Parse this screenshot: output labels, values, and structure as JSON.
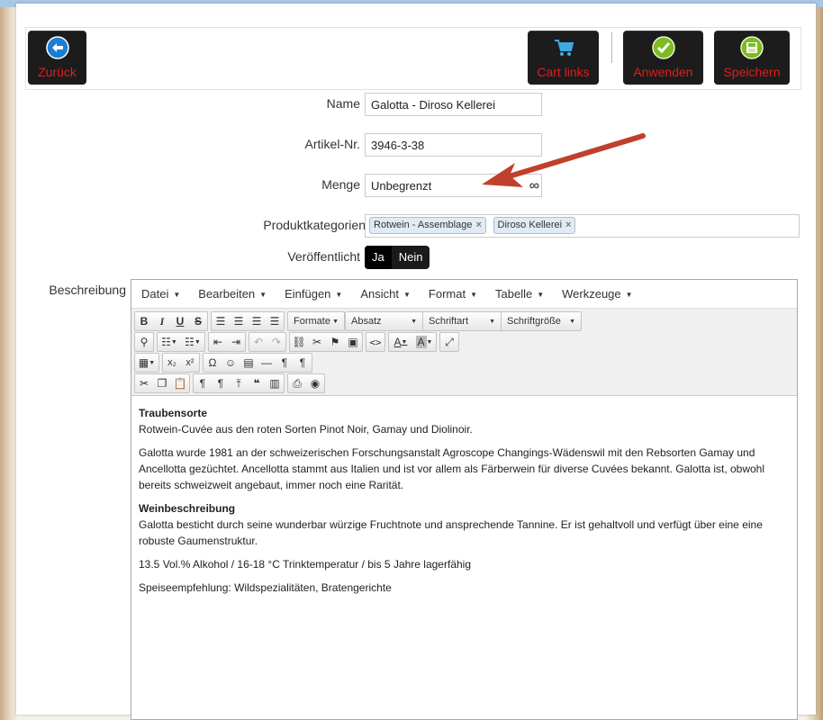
{
  "toolbar": {
    "back_label": "Zurück",
    "cart_label": "Cart links",
    "apply_label": "Anwenden",
    "save_label": "Speichern"
  },
  "form": {
    "name_label": "Name",
    "name_value": "Galotta - Diroso Kellerei",
    "sku_label": "Artikel-Nr.",
    "sku_value": "3946-3-38",
    "qty_label": "Menge",
    "qty_value": "Unbegrenzt",
    "qty_symbol": "∞",
    "category_label": "Produktkategorien",
    "categories": [
      {
        "label": "Rotwein - Assemblage",
        "remove": "×"
      },
      {
        "label": "Diroso Kellerei",
        "remove": "×"
      }
    ],
    "published_label": "Veröffentlicht",
    "published_yes": "Ja",
    "published_no": "Nein",
    "description_label": "Beschreibung"
  },
  "editor": {
    "menu": [
      "Datei",
      "Bearbeiten",
      "Einfügen",
      "Ansicht",
      "Format",
      "Tabelle",
      "Werkzeuge"
    ],
    "dropdowns": {
      "formats": "Formate",
      "paragraph": "Absatz",
      "font": "Schriftart",
      "size": "Schriftgröße"
    },
    "content": {
      "h1": "Traubensorte",
      "p1": "Rotwein-Cuvée aus den roten Sorten Pinot Noir, Gamay und Diolinoir.",
      "p2": "Galotta wurde 1981 an der schweizerischen Forschungsanstalt Agroscope Changings-Wädenswil mit den Rebsorten Gamay und Ancellotta gezüchtet. Ancellotta stammt aus Italien und ist vor allem als Färberwein für diverse Cuvées bekannt. Galotta ist, obwohl bereits schweizweit angebaut, immer noch eine Rarität.",
      "h2": "Weinbeschreibung",
      "p3": "Galotta besticht durch seine wunderbar würzige Fruchtnote und ansprechende Tannine. Er ist gehaltvoll und verfügt über eine eine robuste Gaumenstruktur.",
      "p4": "13.5 Vol.% Alkohol / 16-18 °C Trinktemperatur / bis 5 Jahre lagerfähig",
      "p5": "Speiseempfehlung: Wildspezialitäten, Bratengerichte"
    }
  },
  "colors": {
    "button_bg": "#1c1c1c",
    "button_text": "#e01c1c",
    "back_icon": "#1a7fd4",
    "apply_icon": "#7dbb22",
    "arrow": "#c0402c"
  }
}
